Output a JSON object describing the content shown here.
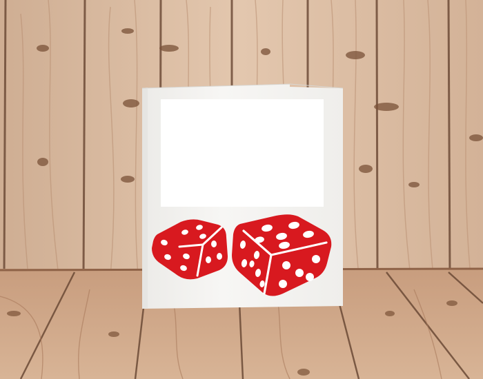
{
  "scene": {
    "description_label": "",
    "colors": {
      "wall_wood": "#d9b99e",
      "wall_wood_light": "#e4c9b0",
      "floor_wood": "#caa182",
      "plank_gap": "#6b4a36",
      "card": "#f4f3f1",
      "card_edge": "#e2e1de",
      "photo_window": "#ffffff",
      "dice_red": "#d8191f",
      "pip_white": "#ffffff"
    }
  },
  "card": {
    "photo_placeholder": "",
    "dice": [
      {
        "name": "left-die",
        "color": "#d8191f",
        "visible_faces": [
          3,
          4,
          3
        ]
      },
      {
        "name": "right-die",
        "color": "#d8191f",
        "visible_faces": [
          4,
          6,
          5
        ]
      }
    ]
  }
}
